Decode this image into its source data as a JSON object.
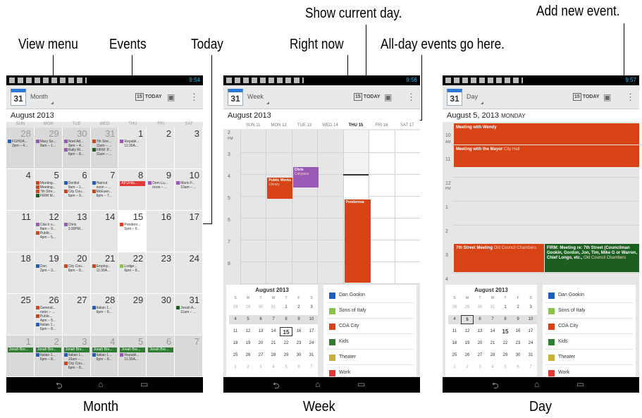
{
  "callouts": {
    "show_current_day": "Show current day.",
    "add_new_event": "Add new event.",
    "view_menu": "View menu",
    "events": "Events",
    "today": "Today",
    "right_now": "Right now",
    "all_day": "All-day events go here."
  },
  "captions": {
    "month": "Month",
    "week": "Week",
    "day": "Day"
  },
  "status": {
    "time_month": "9:54",
    "time_week": "9:56",
    "time_day": "9:57"
  },
  "app": {
    "icon_day": "31",
    "today_badge": "15",
    "today_label": "TODAY"
  },
  "month_view": {
    "view_label": "Month",
    "heading": "August 2013",
    "weekdays": [
      "SUN",
      "MON",
      "TUE",
      "WED",
      "THU",
      "FRI",
      "SAT"
    ],
    "weeks": [
      [
        {
          "d": "28",
          "out": true,
          "ev": [
            {
              "t": "FGHOA...",
              "c": "#1f5fbf"
            },
            {
              "t": "2pm – 4...",
              "c": ""
            }
          ]
        },
        {
          "d": "29",
          "out": true,
          "ev": [
            {
              "t": "Mary So...",
              "c": "#9b59b6"
            },
            {
              "t": "9am – 1...",
              "c": ""
            }
          ]
        },
        {
          "d": "30",
          "out": true,
          "ev": [
            {
              "t": "Noel Ad...",
              "c": "#9b59b6"
            },
            {
              "t": "3pm – 4...",
              "c": ""
            },
            {
              "t": "Rally Ri...",
              "c": "#9b59b6"
            },
            {
              "t": "6pm – 8...",
              "c": ""
            }
          ]
        },
        {
          "d": "31",
          "out": true,
          "ev": [
            {
              "t": "7th Stre...",
              "c": "#d84315"
            },
            {
              "t": "11am – ...",
              "c": ""
            },
            {
              "t": "FIRM: P...",
              "c": "#1b5e20"
            },
            {
              "t": "11am – ...",
              "c": ""
            }
          ]
        },
        {
          "d": "1",
          "ev": [
            {
              "t": "Republi...",
              "c": "#9b59b6"
            },
            {
              "t": "11:30A...",
              "c": ""
            }
          ]
        },
        {
          "d": "2",
          "ev": []
        },
        {
          "d": "3",
          "ev": []
        }
      ],
      [
        {
          "d": "4",
          "ev": []
        },
        {
          "d": "5",
          "ev": [
            {
              "t": "Meeting...",
              "c": "#d84315"
            },
            {
              "t": "Meeting...",
              "c": "#d84315"
            },
            {
              "t": "7th Stre...",
              "c": "#d84315"
            },
            {
              "t": "FIRM M...",
              "c": "#1b5e20"
            }
          ]
        },
        {
          "d": "6",
          "ev": [
            {
              "t": "Dentist",
              "c": "#1f5fbf"
            },
            {
              "t": "9am – 1...",
              "c": ""
            },
            {
              "t": "City Cou...",
              "c": "#d84315"
            },
            {
              "t": "6pm – 9...",
              "c": ""
            }
          ]
        },
        {
          "d": "7",
          "ev": [
            {
              "t": "Haircut",
              "c": "#1f5fbf"
            },
            {
              "t": "noon – ...",
              "c": ""
            },
            {
              "t": "McEuen...",
              "c": "#d84315"
            },
            {
              "t": "6pm – 7...",
              "c": ""
            }
          ]
        },
        {
          "d": "8",
          "ev": [
            {
              "t": "All Units...",
              "c": "#e53935",
              "bar": true
            }
          ]
        },
        {
          "d": "9",
          "ev": [
            {
              "t": "Dem Lu...",
              "c": "#9b59b6"
            },
            {
              "t": "noon – ...",
              "c": ""
            }
          ]
        },
        {
          "d": "10",
          "ev": [
            {
              "t": "Marlo F...",
              "c": "#9b59b6"
            },
            {
              "t": "10am – ...",
              "c": ""
            }
          ]
        }
      ],
      [
        {
          "d": "11",
          "ev": []
        },
        {
          "d": "12",
          "ev": [
            {
              "t": "Cda tr o...",
              "c": "#9b59b6"
            },
            {
              "t": "8am – 9...",
              "c": ""
            },
            {
              "t": "Public...",
              "c": "#d84315"
            },
            {
              "t": "4pm – 5...",
              "c": ""
            }
          ]
        },
        {
          "d": "13",
          "ev": [
            {
              "t": "Chris",
              "c": "#9b59b6"
            },
            {
              "t": "3:30PM...",
              "c": ""
            }
          ]
        },
        {
          "d": "14",
          "ev": []
        },
        {
          "d": "15",
          "today": true,
          "ev": [
            {
              "t": "Pondero...",
              "c": "#d84315"
            },
            {
              "t": "5pm – 9...",
              "c": ""
            }
          ]
        },
        {
          "d": "16",
          "ev": []
        },
        {
          "d": "17",
          "ev": []
        }
      ],
      [
        {
          "d": "18",
          "ev": []
        },
        {
          "d": "19",
          "ev": [
            {
              "t": "Don",
              "c": "#1f5fbf"
            },
            {
              "t": "2pm – 3...",
              "c": ""
            }
          ]
        },
        {
          "d": "20",
          "ev": [
            {
              "t": "City Cou...",
              "c": "#d84315"
            },
            {
              "t": "6pm – 8...",
              "c": ""
            }
          ]
        },
        {
          "d": "21",
          "ev": [
            {
              "t": "Employ...",
              "c": "#d84315"
            },
            {
              "t": "11:30A...",
              "c": ""
            }
          ]
        },
        {
          "d": "22",
          "ev": [
            {
              "t": "Lodge...",
              "c": "#8bc34a"
            },
            {
              "t": "6pm – 8...",
              "c": ""
            }
          ]
        },
        {
          "d": "23",
          "ev": []
        },
        {
          "d": "24",
          "ev": []
        }
      ],
      [
        {
          "d": "25",
          "ev": []
        },
        {
          "d": "26",
          "ev": [
            {
              "t": "General...",
              "c": "#d84315"
            },
            {
              "t": "noon – ...",
              "c": ""
            },
            {
              "t": "Public...",
              "c": "#d84315"
            },
            {
              "t": "4pm – 5...",
              "c": ""
            },
            {
              "t": "Italian 1...",
              "c": "#1f5fbf"
            },
            {
              "t": "6pm – 8...",
              "c": ""
            }
          ]
        },
        {
          "d": "27",
          "ev": []
        },
        {
          "d": "28",
          "ev": [
            {
              "t": "Italian 1...",
              "c": "#1f5fbf"
            },
            {
              "t": "6pm – 8...",
              "c": ""
            }
          ]
        },
        {
          "d": "29",
          "ev": []
        },
        {
          "d": "30",
          "ev": []
        },
        {
          "d": "31",
          "ev": [
            {
              "t": "Jonah A...",
              "c": "#1b5e20"
            },
            {
              "t": "11am – ...",
              "c": ""
            }
          ]
        }
      ],
      [
        {
          "d": "1",
          "out": true,
          "ev": [
            {
              "t": "Jonah Bre...",
              "c": "#2e7d32",
              "bar": true
            }
          ]
        },
        {
          "d": "2",
          "out": true,
          "ev": [
            {
              "t": "Jonah Bre...",
              "c": "#2e7d32",
              "bar": true
            },
            {
              "t": "Italian 1...",
              "c": "#1f5fbf"
            },
            {
              "t": "6pm – 8...",
              "c": ""
            }
          ]
        },
        {
          "d": "3",
          "out": true,
          "ev": [
            {
              "t": "Jonah Bre...",
              "c": "#2e7d32",
              "bar": true
            },
            {
              "t": "Italian 1...",
              "c": "#1f5fbf"
            },
            {
              "t": "10am – ...",
              "c": ""
            },
            {
              "t": "City Cou...",
              "c": "#d84315"
            },
            {
              "t": "6pm – 8...",
              "c": ""
            }
          ]
        },
        {
          "d": "4",
          "out": true,
          "ev": [
            {
              "t": "Jonah Bre...",
              "c": "#2e7d32",
              "bar": true
            },
            {
              "t": "Italian 1...",
              "c": "#1f5fbf"
            },
            {
              "t": "6pm – 8...",
              "c": ""
            }
          ]
        },
        {
          "d": "5",
          "out": true,
          "ev": [
            {
              "t": "Jonah Bre...",
              "c": "#2e7d32",
              "bar": true
            },
            {
              "t": "Republi...",
              "c": "#9b59b6"
            },
            {
              "t": "11:30A...",
              "c": ""
            }
          ]
        },
        {
          "d": "6",
          "out": true,
          "ev": [
            {
              "t": "Jonah Bre...",
              "c": "#2e7d32",
              "bar": true
            }
          ]
        },
        {
          "d": "7",
          "out": true,
          "ev": []
        }
      ]
    ]
  },
  "week_view": {
    "view_label": "Week",
    "heading": "August 2013",
    "days": [
      {
        "label": "SUN 11"
      },
      {
        "label": "MON 12"
      },
      {
        "label": "TUE 13"
      },
      {
        "label": "WED 14"
      },
      {
        "label": "THU 15",
        "bold": true
      },
      {
        "label": "FRI 16"
      },
      {
        "label": "SAT 17"
      }
    ],
    "hours": [
      "2",
      "3",
      "4",
      "5",
      "6",
      "7",
      "8"
    ],
    "pm": "PM",
    "events": [
      {
        "title": "Public Works",
        "sub": "Library",
        "color": "#d84315"
      },
      {
        "title": "Chris",
        "sub": "Calypsos",
        "color": "#9b59b6"
      },
      {
        "title": "Ponderosa",
        "sub": "",
        "color": "#d84315"
      }
    ]
  },
  "day_view": {
    "view_label": "Day",
    "heading": "August 5, 2013",
    "weekday": "MONDAY",
    "hours": [
      "10",
      "11",
      "12",
      "1",
      "2",
      "3",
      "4"
    ],
    "am": "AM",
    "pm": "PM",
    "events": [
      {
        "title": "Meeting with Wendy",
        "sub": "",
        "color": "#d84315"
      },
      {
        "title": "Meeting with the Mayor",
        "sub": "City Hall",
        "color": "#d84315"
      },
      {
        "title": "7th Street Meeting",
        "sub": "Old Council Chambers",
        "color": "#d84315"
      },
      {
        "title": "FIRM: Meeting re: 7th Street (Councilman Gookin, Gordon, Jon, Tim, Mike G or Warren, Chief Longo, etc.,",
        "sub": "Old Council Chambers",
        "color": "#1b5e20"
      }
    ]
  },
  "mini_calendar": {
    "title": "August 2013",
    "weekdays": [
      "S",
      "M",
      "T",
      "W",
      "T",
      "F",
      "S"
    ],
    "rows": [
      [
        "28",
        "29",
        "30",
        "31",
        "1",
        "2",
        "3"
      ],
      [
        "4",
        "5",
        "6",
        "7",
        "8",
        "9",
        "10"
      ],
      [
        "11",
        "12",
        "13",
        "14",
        "15",
        "16",
        "17"
      ],
      [
        "18",
        "19",
        "20",
        "21",
        "22",
        "23",
        "24"
      ],
      [
        "25",
        "26",
        "27",
        "28",
        "29",
        "30",
        "31"
      ],
      [
        "1",
        "2",
        "3",
        "4",
        "5",
        "6",
        "7"
      ]
    ]
  },
  "calendars": [
    {
      "name": "Dan Gookin",
      "color": "#1f5fbf"
    },
    {
      "name": "Sons of Italy",
      "color": "#8bc34a"
    },
    {
      "name": "CDA City",
      "color": "#d84315"
    },
    {
      "name": "Kids",
      "color": "#2e7d32"
    },
    {
      "name": "Theater",
      "color": "#c9b037"
    },
    {
      "name": "Work",
      "color": "#e53935"
    }
  ],
  "colors": {
    "accent": "#2a7bd5",
    "status_blue": "#33b5e5"
  }
}
